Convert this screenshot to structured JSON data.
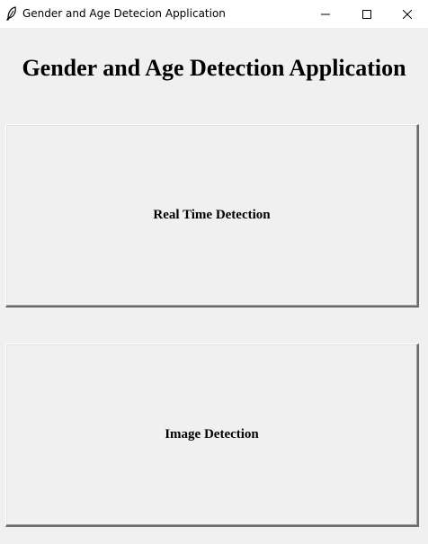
{
  "window": {
    "title": "Gender and Age Detecion Application",
    "icon": "feather-icon",
    "controls": {
      "minimize_icon": "minimize-icon",
      "maximize_icon": "maximize-icon",
      "close_icon": "close-icon"
    }
  },
  "main": {
    "heading": "Gender and Age Detection Application",
    "buttons": {
      "realtime_label": "Real Time Detection",
      "image_label": "Image Detection"
    }
  },
  "colors": {
    "background": "#f0f0f0",
    "titlebar": "#ffffff",
    "text": "#000000"
  }
}
